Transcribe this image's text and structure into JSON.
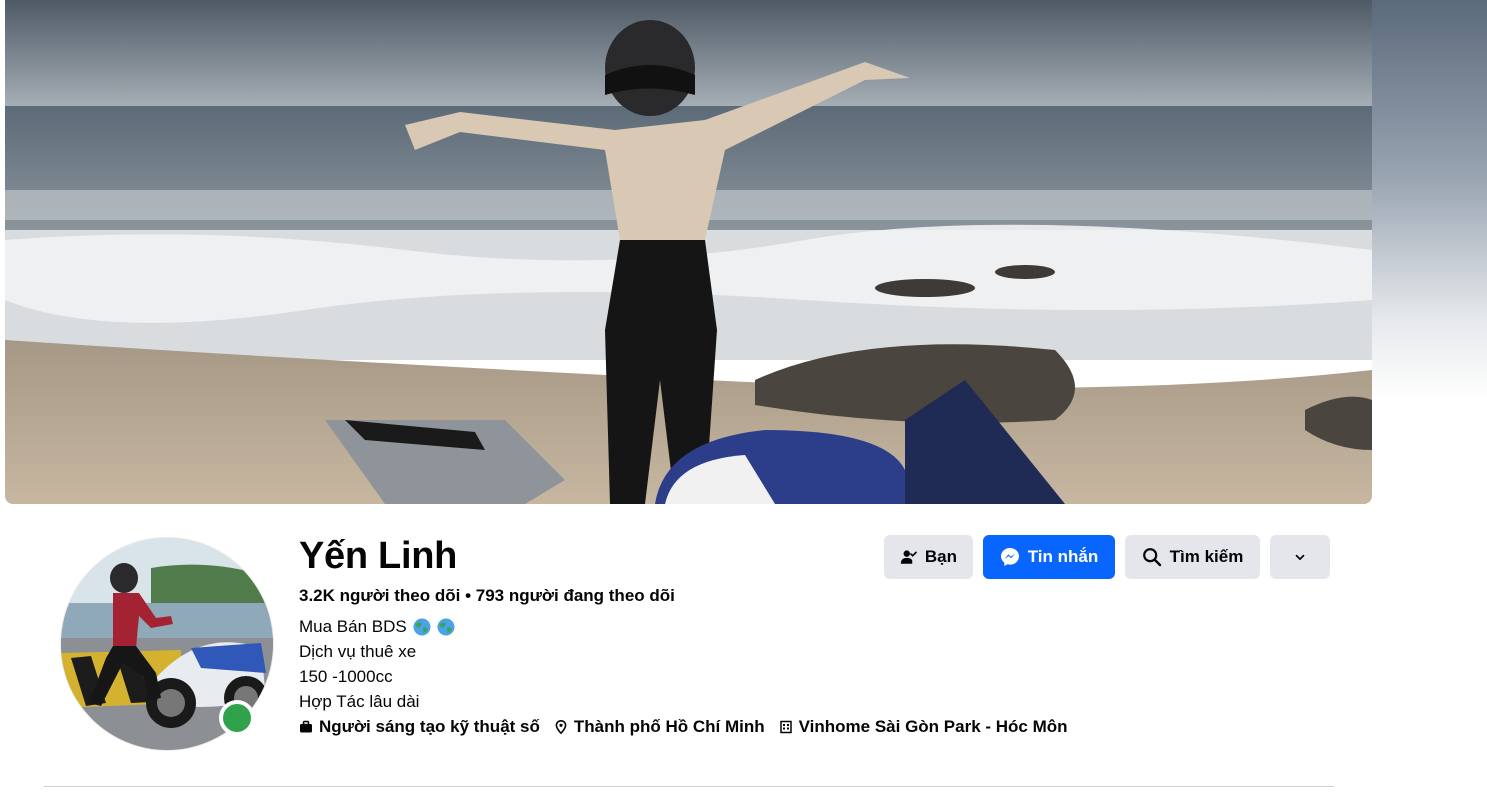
{
  "profile": {
    "name": "Yến Linh",
    "followers": "3.2K người theo dõi • 793 người đang theo dõi",
    "bio": {
      "line1": "Mua Bán BDS",
      "line2": "Dịch vụ thuê xe",
      "line3": "150 -1000cc",
      "line4": "Hợp Tác lâu dài"
    },
    "details": {
      "category": "Người sáng tạo kỹ thuật số",
      "location": "Thành phố Hồ Chí Minh",
      "workplace": "Vinhome Sài Gòn Park - Hóc Môn"
    },
    "online": true
  },
  "actions": {
    "friend_label": "Bạn",
    "message_label": "Tin nhắn",
    "search_label": "Tìm kiếm"
  },
  "colors": {
    "primary_blue": "#0866ff",
    "button_grey": "#e4e6eb",
    "online_green": "#31a24c"
  },
  "icons": {
    "friend": "person-check-icon",
    "message": "messenger-icon",
    "search": "search-icon",
    "more": "chevron-down-icon",
    "category": "briefcase-icon",
    "location": "location-pin-icon",
    "workplace": "building-icon",
    "globe": "globe-emoji-icon"
  }
}
